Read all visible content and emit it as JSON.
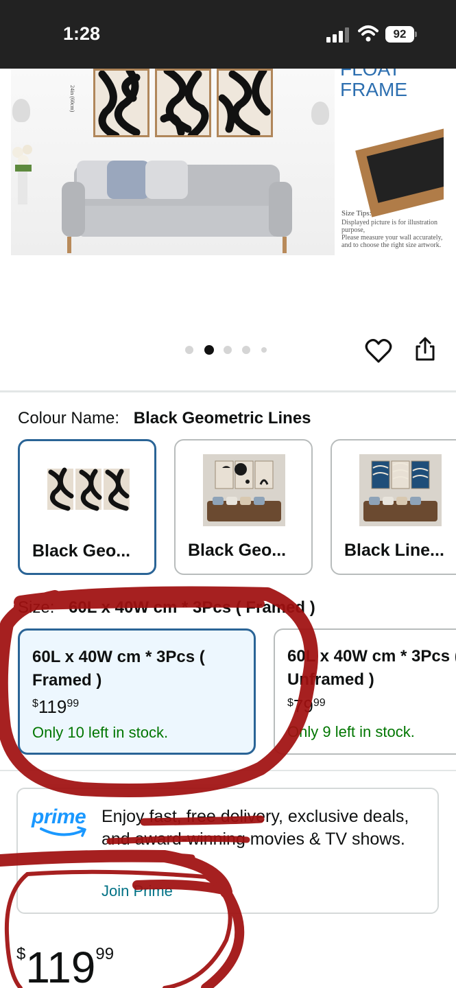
{
  "status_bar": {
    "time": "1:28",
    "battery": "92"
  },
  "hero": {
    "title_partial": "FLOAT",
    "title": "FRAME",
    "height_label": "24in (60cm)",
    "size_tips": {
      "title": "Size Tips:",
      "line1": "Displayed picture is for illustration purpose,",
      "line2": "Please measure your wall accurately,",
      "line3": "and to choose the right size artwork."
    }
  },
  "carousel": {
    "count": 5,
    "active_index": 1
  },
  "actions": {
    "wishlist_icon": "heart-icon",
    "share_icon": "share-icon"
  },
  "colour": {
    "label": "Colour Name:",
    "selected": "Black Geometric Lines",
    "options": [
      {
        "label": "Black Geo...",
        "selected": true
      },
      {
        "label": "Black Geo...",
        "selected": false
      },
      {
        "label": "Black Line...",
        "selected": false
      }
    ]
  },
  "size": {
    "label": "Size:",
    "selected": "60L x 40W cm * 3Pcs ( Framed )",
    "options": [
      {
        "name": "60L x 40W cm * 3Pcs ( Framed )",
        "currency": "$",
        "price_whole": "119",
        "price_fraction": "99",
        "stock": "Only 10 left in stock.",
        "selected": true
      },
      {
        "name": "60L x 40W cm * 3Pcs ( Unframed )",
        "currency": "$",
        "price_whole": "79",
        "price_fraction": "99",
        "stock": "Only 9 left in stock.",
        "selected": false
      }
    ]
  },
  "prime": {
    "logo": "prime",
    "text": "Enjoy fast, free delivery, exclusive deals, and award-winning movies & TV shows.",
    "link": "Join Prime"
  },
  "price": {
    "currency": "$",
    "whole": "119",
    "fraction": "99"
  },
  "colors": {
    "accent_blue": "#2a6496",
    "link": "#007185",
    "stock_green": "#007600",
    "prime_blue": "#1a98ff",
    "annotation_red": "#a01010"
  }
}
